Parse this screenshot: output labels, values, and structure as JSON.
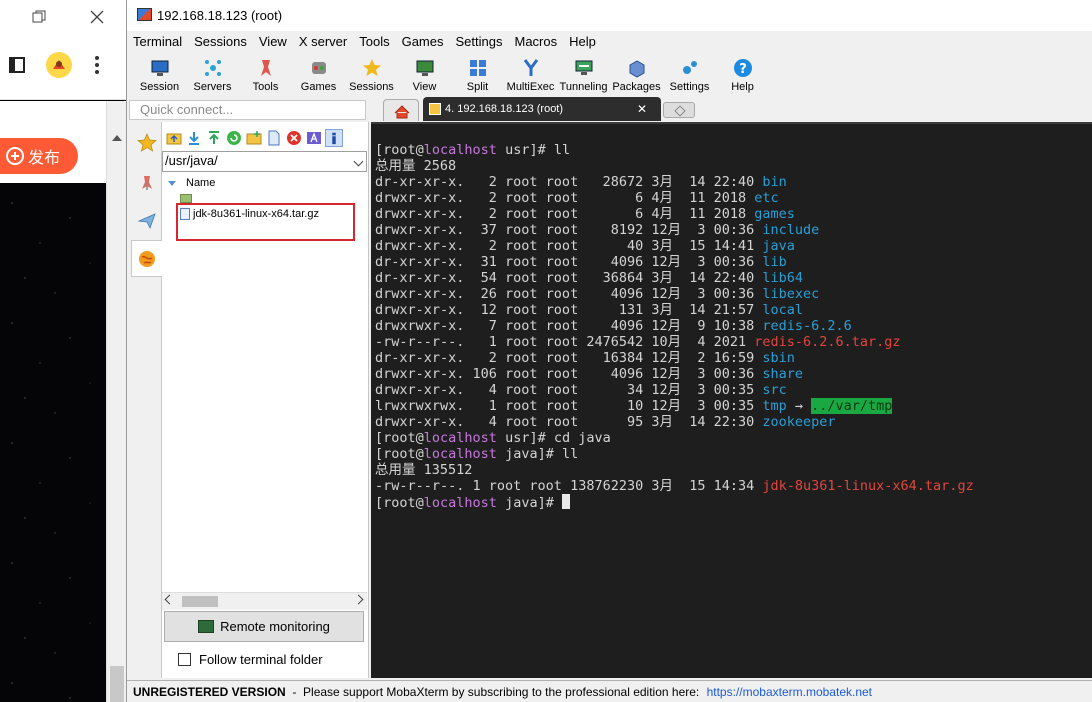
{
  "browser": {
    "publish_label": "发布"
  },
  "window": {
    "title": "192.168.18.123 (root)"
  },
  "menu": [
    "Terminal",
    "Sessions",
    "View",
    "X server",
    "Tools",
    "Games",
    "Settings",
    "Macros",
    "Help"
  ],
  "toolbar": [
    {
      "label": "Session",
      "icon": "monitor-icon"
    },
    {
      "label": "Servers",
      "icon": "servers-icon"
    },
    {
      "label": "Tools",
      "icon": "tools-icon"
    },
    {
      "label": "Games",
      "icon": "games-icon"
    },
    {
      "label": "Sessions",
      "icon": "star-icon"
    },
    {
      "label": "View",
      "icon": "view-icon"
    },
    {
      "label": "Split",
      "icon": "split-icon"
    },
    {
      "label": "MultiExec",
      "icon": "multiexec-icon"
    },
    {
      "label": "Tunneling",
      "icon": "tunneling-icon"
    },
    {
      "label": "Packages",
      "icon": "packages-icon"
    },
    {
      "label": "Settings",
      "icon": "gears-icon"
    },
    {
      "label": "Help",
      "icon": "help-icon"
    }
  ],
  "quick_connect": {
    "placeholder": "Quick connect..."
  },
  "tabs": {
    "session_label": "4. 192.168.18.123 (root)"
  },
  "sftp": {
    "path": "/usr/java/",
    "column_name": "Name",
    "files": [
      "jdk-8u361-linux-x64.tar.gz"
    ],
    "remote_monitoring": "Remote monitoring",
    "follow_terminal": "Follow terminal folder"
  },
  "terminal": {
    "lines": [
      [
        {
          "t": "[root@"
        },
        {
          "t": "localhost",
          "c": "purple"
        },
        {
          "t": " usr]# ll"
        }
      ],
      [
        {
          "t": "总用量 2568"
        }
      ],
      [
        {
          "t": "dr-xr-xr-x.   2 root root   28672 3月  14 22:40 "
        },
        {
          "t": "bin",
          "c": "blue"
        }
      ],
      [
        {
          "t": "drwxr-xr-x.   2 root root       6 4月  11 2018 "
        },
        {
          "t": "etc",
          "c": "blue"
        }
      ],
      [
        {
          "t": "drwxr-xr-x.   2 root root       6 4月  11 2018 "
        },
        {
          "t": "games",
          "c": "blue"
        }
      ],
      [
        {
          "t": "drwxr-xr-x.  37 root root    8192 12月  3 00:36 "
        },
        {
          "t": "include",
          "c": "blue"
        }
      ],
      [
        {
          "t": "drwxr-xr-x.   2 root root      40 3月  15 14:41 "
        },
        {
          "t": "java",
          "c": "blue"
        }
      ],
      [
        {
          "t": "dr-xr-xr-x.  31 root root    4096 12月  3 00:36 "
        },
        {
          "t": "lib",
          "c": "blue"
        }
      ],
      [
        {
          "t": "dr-xr-xr-x.  54 root root   36864 3月  14 22:40 "
        },
        {
          "t": "lib64",
          "c": "blue"
        }
      ],
      [
        {
          "t": "drwxr-xr-x.  26 root root    4096 12月  3 00:36 "
        },
        {
          "t": "libexec",
          "c": "blue"
        }
      ],
      [
        {
          "t": "drwxr-xr-x.  12 root root     131 3月  14 21:57 "
        },
        {
          "t": "local",
          "c": "blue"
        }
      ],
      [
        {
          "t": "drwxrwxr-x.   7 root root    4096 12月  9 10:38 "
        },
        {
          "t": "redis-6.2.6",
          "c": "blue"
        }
      ],
      [
        {
          "t": "-rw-r--r--.   1 root root 2476542 10月  4 2021 "
        },
        {
          "t": "redis-6.2.6.tar.gz",
          "c": "red"
        }
      ],
      [
        {
          "t": "dr-xr-xr-x.   2 root root   16384 12月  2 16:59 "
        },
        {
          "t": "sbin",
          "c": "blue"
        }
      ],
      [
        {
          "t": "drwxr-xr-x. 106 root root    4096 12月  3 00:36 "
        },
        {
          "t": "share",
          "c": "blue"
        }
      ],
      [
        {
          "t": "drwxr-xr-x.   4 root root      34 12月  3 00:35 "
        },
        {
          "t": "src",
          "c": "blue"
        }
      ],
      [
        {
          "t": "lrwxrwxrwx.   1 root root      10 12月  3 00:35 "
        },
        {
          "t": "tmp",
          "c": "blue"
        },
        {
          "t": " → "
        },
        {
          "t": "../var/tmp",
          "c": "tmp"
        }
      ],
      [
        {
          "t": "drwxr-xr-x.   4 root root      95 3月  14 22:30 "
        },
        {
          "t": "zookeeper",
          "c": "blue"
        }
      ],
      [
        {
          "t": "[root@"
        },
        {
          "t": "localhost",
          "c": "purple"
        },
        {
          "t": " usr]# cd java"
        }
      ],
      [
        {
          "t": "[root@"
        },
        {
          "t": "localhost",
          "c": "purple"
        },
        {
          "t": " java]# ll"
        }
      ],
      [
        {
          "t": "总用量 135512"
        }
      ],
      [
        {
          "t": "-rw-r--r--. 1 root root 138762230 3月  15 14:34 "
        },
        {
          "t": "jdk-8u361-linux-x64.tar.gz",
          "c": "red"
        }
      ],
      [
        {
          "t": "[root@"
        },
        {
          "t": "localhost",
          "c": "purple"
        },
        {
          "t": " java]# "
        },
        {
          "t": "",
          "c": "cursor"
        }
      ]
    ]
  },
  "status": {
    "unregistered": "UNREGISTERED VERSION",
    "message": "  -  Please support MobaXterm by subscribing to the professional edition here: ",
    "link": "https://mobaxterm.mobatek.net"
  }
}
